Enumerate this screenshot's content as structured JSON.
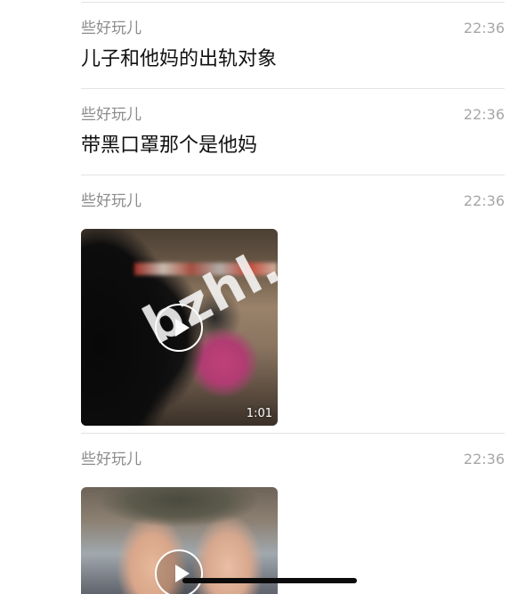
{
  "messages": [
    {
      "sender": "些好玩儿",
      "time": "22:36",
      "text": "儿子和他妈的出轨对象"
    },
    {
      "sender": "些好玩儿",
      "time": "22:36",
      "text": "带黑口罩那个是他妈"
    },
    {
      "sender": "些好玩儿",
      "time": "22:36",
      "video": {
        "duration": "1:01"
      }
    },
    {
      "sender": "些好玩儿",
      "time": "22:36",
      "video": {}
    }
  ],
  "watermark": "bzhl."
}
